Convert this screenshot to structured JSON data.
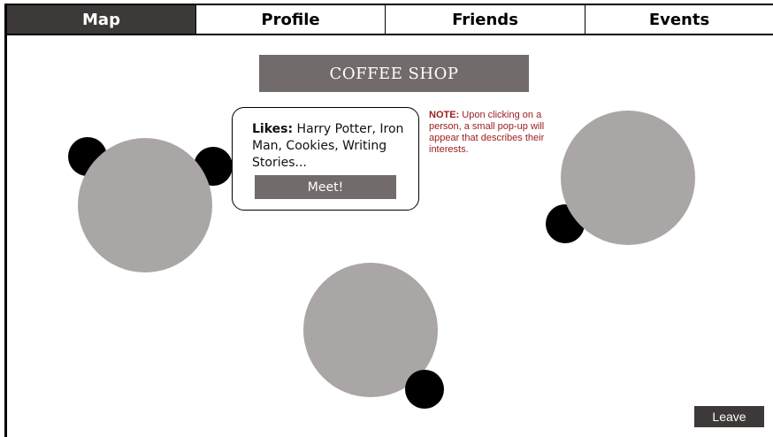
{
  "nav": {
    "tabs": [
      {
        "label": "Map",
        "active": true
      },
      {
        "label": "Profile",
        "active": false
      },
      {
        "label": "Friends",
        "active": false
      },
      {
        "label": "Events",
        "active": false
      }
    ]
  },
  "location": {
    "title": "COFFEE SHOP"
  },
  "popup": {
    "likes_label": "Likes:",
    "likes_text": "Harry Potter, Iron Man, Cookies, Writing Stories...",
    "meet_label": "Meet!"
  },
  "note": {
    "label": "NOTE:",
    "text": "Upon clicking on a person, a small pop-up will appear that describes their interests."
  },
  "actions": {
    "leave_label": "Leave"
  },
  "colors": {
    "active_tab": "#3d3938",
    "banner": "#716b6b",
    "table": "#aaa6a5",
    "person": "#000000",
    "note_text": "#9b1c1c"
  }
}
